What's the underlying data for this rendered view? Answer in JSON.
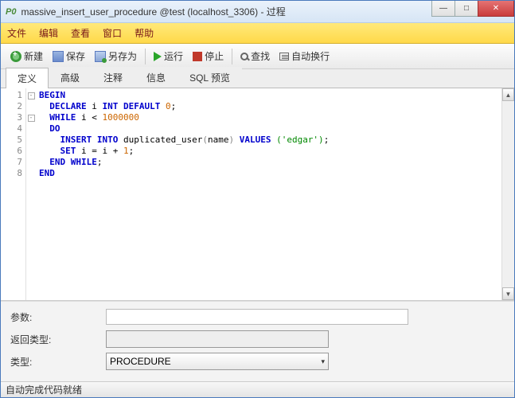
{
  "window": {
    "app_icon": "P0",
    "title": "massive_insert_user_procedure @test (localhost_3306) - 过程"
  },
  "menu": {
    "file": "文件",
    "edit": "编辑",
    "view": "查看",
    "window": "窗口",
    "help": "帮助"
  },
  "toolbar": {
    "new": "新建",
    "save": "保存",
    "saveas": "另存为",
    "run": "运行",
    "stop": "停止",
    "find": "查找",
    "wrap": "自动换行"
  },
  "tabs": {
    "definition": "定义",
    "advanced": "高级",
    "comment": "注释",
    "info": "信息",
    "sql_preview": "SQL 预览"
  },
  "code": {
    "lines": [
      "1",
      "2",
      "3",
      "4",
      "5",
      "6",
      "7",
      "8"
    ],
    "l1_begin": "BEGIN",
    "l2_declare": "DECLARE",
    "l2_var": " i ",
    "l2_intdefault": "INT DEFAULT",
    "l2_zero": " 0",
    "l3_while": "WHILE",
    "l3_cond_a": " i < ",
    "l3_cond_b": "1000000",
    "l4_do": "DO",
    "l5_insert": "INSERT INTO",
    "l5_tbl": " duplicated_user",
    "l5_paren_open": "(",
    "l5_col": "name",
    "l5_paren_close": ") ",
    "l5_values": "VALUES",
    "l5_val": " ('edgar')",
    "l6_set": "SET",
    "l6_expr_a": " i = i + ",
    "l6_expr_b": "1",
    "l7_endwhile": "END WHILE",
    "l8_end": "END"
  },
  "form": {
    "params_label": "参数:",
    "params_value": "",
    "return_label": "返回类型:",
    "return_value": "",
    "type_label": "类型:",
    "type_value": "PROCEDURE"
  },
  "status": {
    "text": "自动完成代码就绪"
  }
}
